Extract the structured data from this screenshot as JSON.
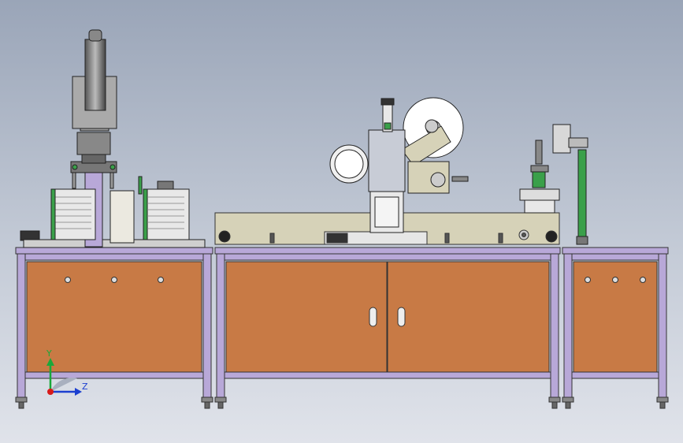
{
  "scene": {
    "axes": {
      "y_label": "Y",
      "z_label": "Z"
    },
    "colors": {
      "frame": "#b8a8d8",
      "panel": "#c87a45",
      "plate": "#d6d2b8",
      "roller": "#ffffff",
      "coil": "#3aa04a",
      "y_axis": "#1aa83a",
      "z_axis": "#1c3fd0",
      "origin": "#d81a1a"
    }
  }
}
